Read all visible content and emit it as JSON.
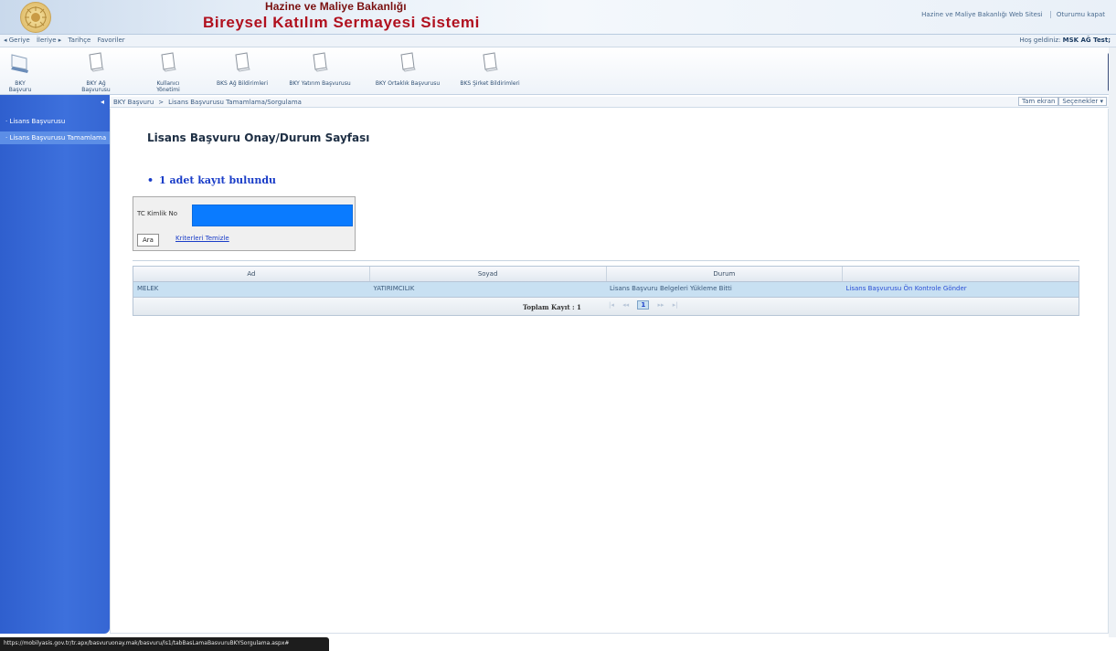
{
  "header": {
    "ministry": "Hazine ve Maliye Bakanlığı",
    "system_title": "Bireysel Katılım Sermayesi Sistemi",
    "links": [
      "Hazine ve Maliye Bakanlığı Web Sitesi",
      "Oturumu kapat"
    ]
  },
  "navbar": {
    "back": "◂ Geriye",
    "forward": "İleriye ▸",
    "history": "Tarihçe",
    "favorites": "Favoriler",
    "welcome_prefix": "Hoş geldiniz:",
    "user": "MSK AĞ Test;"
  },
  "toolbar": {
    "items": [
      {
        "label": "BKY Başvuru",
        "icon": "monitor-icon"
      },
      {
        "label": "BKY Ağ Başvurusu",
        "icon": "document-icon"
      },
      {
        "label": "Kullanıcı Yönetimi",
        "icon": "document-icon"
      },
      {
        "label": "BKS Ağ Bildirimleri",
        "icon": "document-icon"
      },
      {
        "label": "BKY Yatırım Başvurusu",
        "icon": "document-icon"
      },
      {
        "label": "BKY Ortaklık Başvurusu",
        "icon": "document-icon"
      },
      {
        "label": "BKS Şirket Bildirimleri",
        "icon": "document-icon"
      }
    ]
  },
  "sidebar": {
    "items": [
      {
        "label": "· Lisans Başvurusu",
        "active": false
      },
      {
        "label": "· Lisans Başvurusu Tamamlama",
        "active": true
      }
    ]
  },
  "breadcrumb": {
    "root": "BKY Başvuru",
    "separator": ">",
    "current": "Lisans Başvurusu Tamamlama/Sorgulama",
    "right_tab": "Tam ekran",
    "right_menu": "Seçenekler ▾"
  },
  "page": {
    "title": "Lisans Başvuru Onay/Durum Sayfası",
    "result_bullet": "•",
    "result_count": "1 adet kayıt bulundu"
  },
  "search": {
    "tc_label": "TC Kimlik No",
    "tc_value": "",
    "button": "Ara",
    "clear_link": "Kriterleri Temizle"
  },
  "grid": {
    "columns": [
      "Ad",
      "Soyad",
      "Durum",
      ""
    ],
    "rows": [
      [
        "MELEK",
        "YATIRIMCILIK",
        "Lisans Başvuru Belgeleri Yükleme Bitti",
        "Lisans Başvurusu Ön Kontrole Gönder"
      ]
    ],
    "total_label": "Toplam Kayıt : 1",
    "pager": {
      "first": "|◂",
      "prev": "◂◂",
      "current": "1",
      "next": "▸▸",
      "last": "▸|"
    }
  },
  "status_url": "https://mobilyasis.gov.tr/tr.apx/basvuruonay.mak/basvuru/ls1/tabBasLamaBasvuruBKYSorgulama.aspx#"
}
